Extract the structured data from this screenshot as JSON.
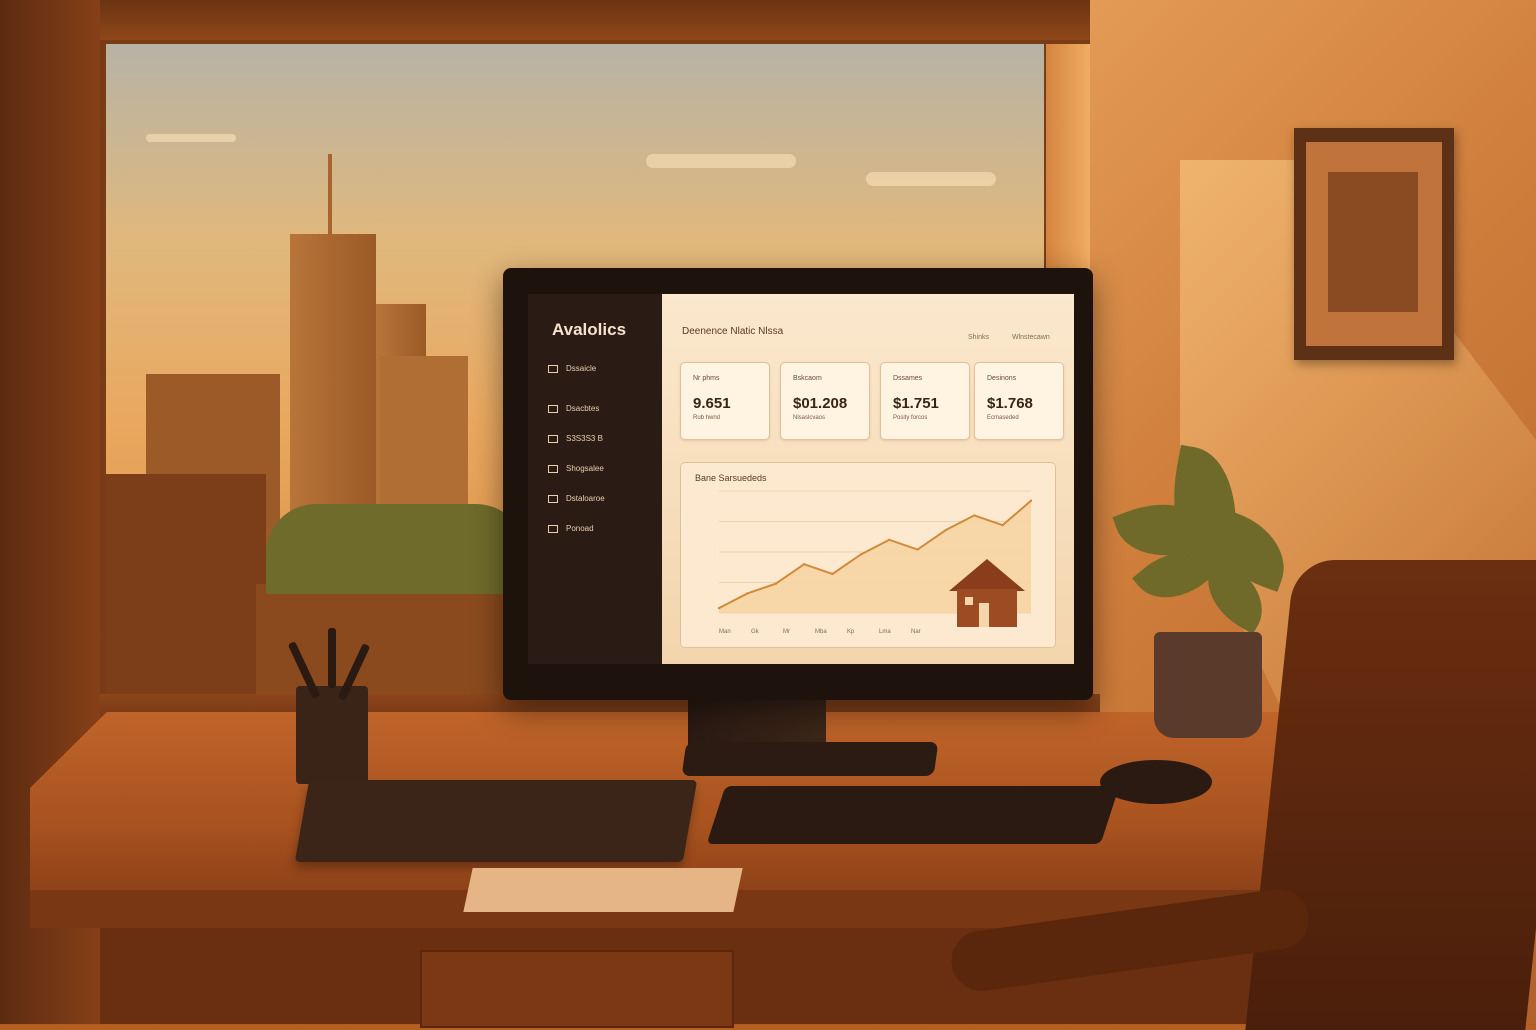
{
  "app": {
    "brand": "Avalolics",
    "title": "Deenence Nlatic Nlssa",
    "header_right": [
      "Shinks",
      "Wlnstecawn"
    ]
  },
  "sidebar": {
    "items": [
      {
        "label": "Dssaicle"
      },
      {
        "label": "Dsacbtes"
      },
      {
        "label": "S3S3S3 B"
      },
      {
        "label": "Shogsalee"
      },
      {
        "label": "Dstaloaroe"
      },
      {
        "label": "Ponoad"
      }
    ]
  },
  "cards": [
    {
      "label": "Nr phms",
      "value": "9.651",
      "sub": "Rub hwnd"
    },
    {
      "label": "Bskcaom",
      "value": "$01.208",
      "sub": "Nlsaslcvaos"
    },
    {
      "label": "Dssames",
      "value": "$1.751",
      "sub": "Posity forcos"
    },
    {
      "label": "Desinons",
      "value": "$1.768",
      "sub": "Ecmaseded"
    }
  ],
  "chart_data": {
    "type": "area",
    "title": "Bane Sarsuededs",
    "x": [
      "Man",
      "Gk",
      "Mr",
      "Mba",
      "Kp",
      "Lma",
      "Nar"
    ],
    "series": [
      {
        "values": [
          2,
          8,
          12,
          20,
          16,
          24,
          30,
          26,
          34,
          40,
          36,
          46
        ]
      }
    ],
    "ylim": [
      0,
      50
    ],
    "grid": true,
    "accent": "#d28a3a"
  },
  "colors": {
    "accent": "#d28a3a",
    "sidebar_bg": "#2b1b15",
    "panel_bg": "#fde9cf"
  }
}
